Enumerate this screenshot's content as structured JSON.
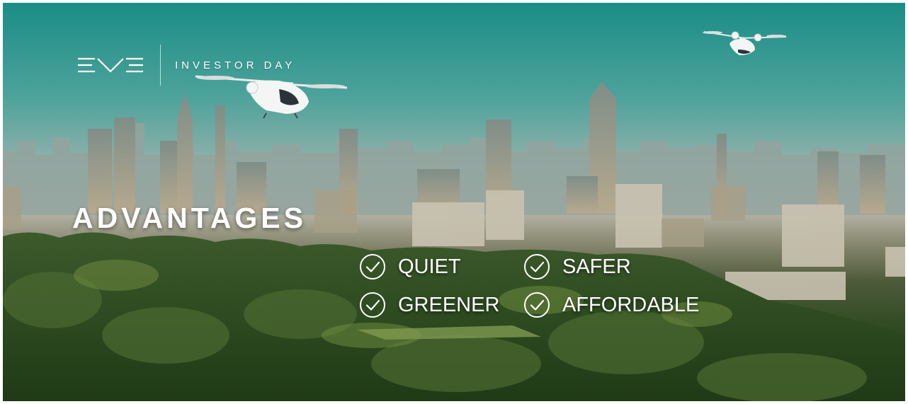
{
  "brand": {
    "logo_icon": "eve-logo-icon",
    "event_title": "INVESTOR DAY"
  },
  "headline": "ADVANTAGES",
  "advantages": [
    {
      "label": "QUIET",
      "icon": "check-circle-icon"
    },
    {
      "label": "SAFER",
      "icon": "check-circle-icon"
    },
    {
      "label": "GREENER",
      "icon": "check-circle-icon"
    },
    {
      "label": "AFFORDABLE",
      "icon": "check-circle-icon"
    }
  ],
  "colors": {
    "text": "#ffffff",
    "sky": "#2f9a92",
    "foliage": "#2f4a22"
  }
}
